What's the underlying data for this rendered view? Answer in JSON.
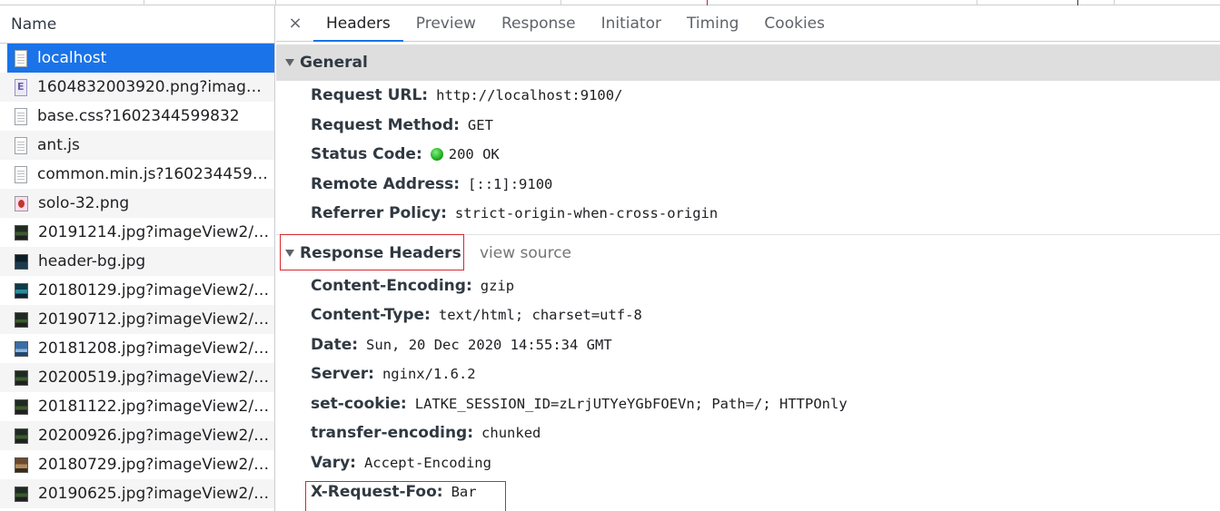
{
  "request_list": {
    "header": "Name",
    "items": [
      {
        "label": "localhost",
        "icon": "document-icon",
        "selected": true
      },
      {
        "label": "1604832003920.png?imageVi...",
        "icon": "image-e-icon"
      },
      {
        "label": "base.css?1602344599832",
        "icon": "document-icon"
      },
      {
        "label": "ant.js",
        "icon": "document-icon"
      },
      {
        "label": "common.min.js?16023445998...",
        "icon": "document-icon"
      },
      {
        "label": "solo-32.png",
        "icon": "image-icon"
      },
      {
        "label": "20191214.jpg?imageView2/1/...",
        "icon": "image-icon"
      },
      {
        "label": "header-bg.jpg",
        "icon": "image-icon"
      },
      {
        "label": "20180129.jpg?imageView2/1/...",
        "icon": "image-icon"
      },
      {
        "label": "20190712.jpg?imageView2/1/...",
        "icon": "image-icon"
      },
      {
        "label": "20181208.jpg?imageView2/1/...",
        "icon": "image-icon"
      },
      {
        "label": "20200519.jpg?imageView2/1/...",
        "icon": "image-icon"
      },
      {
        "label": "20181122.jpg?imageView2/1/...",
        "icon": "image-icon"
      },
      {
        "label": "20200926.jpg?imageView2/1/...",
        "icon": "image-icon"
      },
      {
        "label": "20180729.jpg?imageView2/1/...",
        "icon": "image-icon"
      },
      {
        "label": "20190625.jpg?imageView2/1/...",
        "icon": "image-icon"
      }
    ]
  },
  "tabs": {
    "close": "×",
    "items": [
      "Headers",
      "Preview",
      "Response",
      "Initiator",
      "Timing",
      "Cookies"
    ],
    "active": "Headers"
  },
  "general": {
    "title": "General",
    "rows": [
      {
        "key": "Request URL:",
        "value": "http://localhost:9100/"
      },
      {
        "key": "Request Method:",
        "value": "GET"
      },
      {
        "key": "Status Code:",
        "value": "200 OK",
        "status_color": "#12a012"
      },
      {
        "key": "Remote Address:",
        "value": "[::1]:9100"
      },
      {
        "key": "Referrer Policy:",
        "value": "strict-origin-when-cross-origin"
      }
    ]
  },
  "response_headers": {
    "title": "Response Headers",
    "view_source": "view source",
    "rows": [
      {
        "key": "Content-Encoding:",
        "value": "gzip"
      },
      {
        "key": "Content-Type:",
        "value": "text/html; charset=utf-8"
      },
      {
        "key": "Date:",
        "value": "Sun, 20 Dec 2020 14:55:34 GMT"
      },
      {
        "key": "Server:",
        "value": "nginx/1.6.2"
      },
      {
        "key": "set-cookie:",
        "value": "LATKE_SESSION_ID=zLrjUTYeYGbFOEVn; Path=/; HTTPOnly"
      },
      {
        "key": "transfer-encoding:",
        "value": "chunked"
      },
      {
        "key": "Vary:",
        "value": "Accept-Encoding"
      },
      {
        "key": "X-Request-Foo:",
        "value": "Bar"
      }
    ]
  },
  "colors": {
    "accent": "#1a73e8",
    "highlight_box": "#d9272e"
  }
}
